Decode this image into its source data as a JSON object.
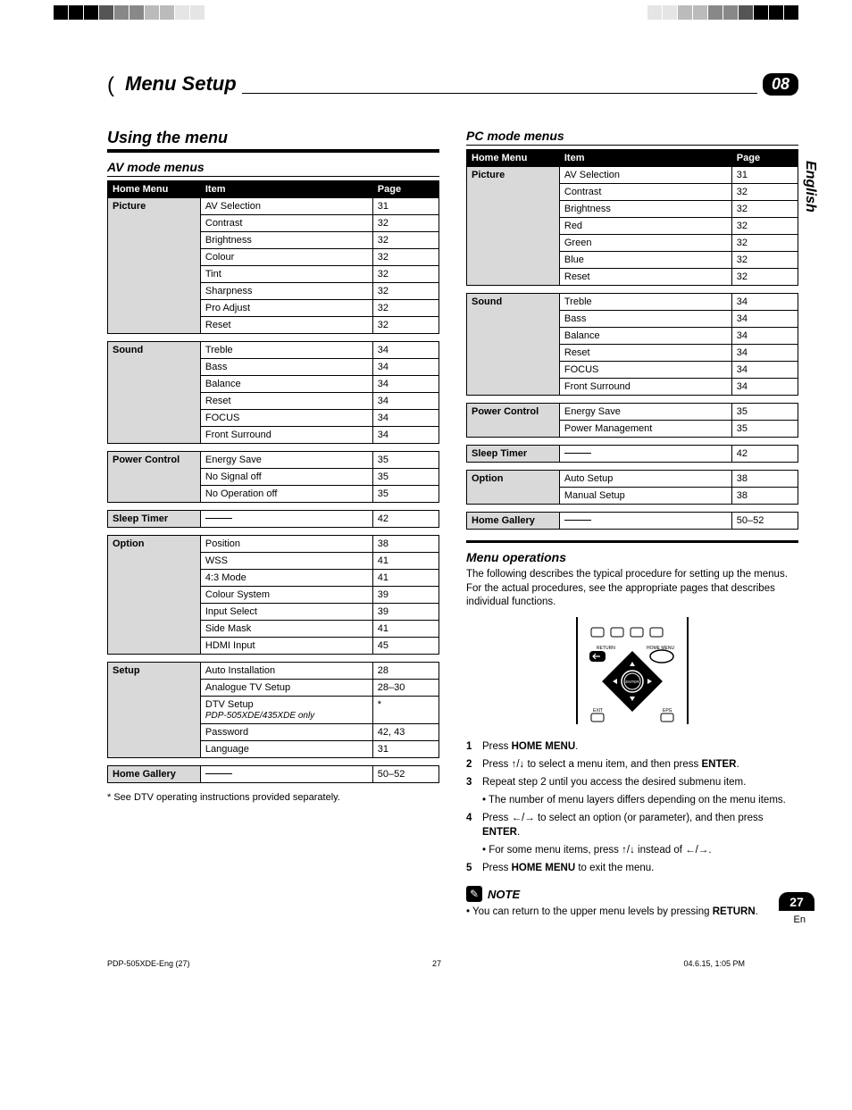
{
  "chapter": {
    "title": "Menu Setup",
    "number": "08"
  },
  "language_tab": "English",
  "page_number": "27",
  "page_lang": "En",
  "left": {
    "section_title": "Using the menu",
    "sub_title": "AV mode menus",
    "tables": {
      "headers": [
        "Home Menu",
        "Item",
        "Page"
      ],
      "groups": [
        {
          "home": "Picture",
          "rows": [
            {
              "item": "AV Selection",
              "page": "31"
            },
            {
              "item": "Contrast",
              "page": "32"
            },
            {
              "item": "Brightness",
              "page": "32"
            },
            {
              "item": "Colour",
              "page": "32"
            },
            {
              "item": "Tint",
              "page": "32"
            },
            {
              "item": "Sharpness",
              "page": "32"
            },
            {
              "item": "Pro Adjust",
              "page": "32"
            },
            {
              "item": "Reset",
              "page": "32"
            }
          ]
        },
        {
          "home": "Sound",
          "rows": [
            {
              "item": "Treble",
              "page": "34"
            },
            {
              "item": "Bass",
              "page": "34"
            },
            {
              "item": "Balance",
              "page": "34"
            },
            {
              "item": "Reset",
              "page": "34"
            },
            {
              "item": "FOCUS",
              "page": "34"
            },
            {
              "item": "Front Surround",
              "page": "34"
            }
          ]
        },
        {
          "home": "Power Control",
          "rows": [
            {
              "item": "Energy Save",
              "page": "35"
            },
            {
              "item": "No Signal off",
              "page": "35"
            },
            {
              "item": "No Operation off",
              "page": "35"
            }
          ]
        },
        {
          "home": "Sleep Timer",
          "rows": [
            {
              "item": "—",
              "page": "42",
              "dash": true
            }
          ]
        },
        {
          "home": "Option",
          "rows": [
            {
              "item": "Position",
              "page": "38"
            },
            {
              "item": "WSS",
              "page": "41"
            },
            {
              "item": "4:3 Mode",
              "page": "41"
            },
            {
              "item": "Colour System",
              "page": "39"
            },
            {
              "item": "Input Select",
              "page": "39"
            },
            {
              "item": "Side Mask",
              "page": "41"
            },
            {
              "item": "HDMI Input",
              "page": "45"
            }
          ]
        },
        {
          "home": "Setup",
          "rows": [
            {
              "item": "Auto Installation",
              "page": "28"
            },
            {
              "item": "Analogue TV Setup",
              "page": "28–30"
            },
            {
              "item": "DTV Setup",
              "sub": "PDP-505XDE/435XDE only",
              "page": "*"
            },
            {
              "item": "Password",
              "page": "42, 43"
            },
            {
              "item": "Language",
              "page": "31"
            }
          ]
        },
        {
          "home": "Home Gallery",
          "rows": [
            {
              "item": "—",
              "page": "50–52",
              "dash": true
            }
          ]
        }
      ]
    },
    "footnote": "* See DTV operating instructions provided separately."
  },
  "right": {
    "sub_title": "PC mode menus",
    "tables": {
      "headers": [
        "Home Menu",
        "Item",
        "Page"
      ],
      "groups": [
        {
          "home": "Picture",
          "rows": [
            {
              "item": "AV Selection",
              "page": "31"
            },
            {
              "item": "Contrast",
              "page": "32"
            },
            {
              "item": "Brightness",
              "page": "32"
            },
            {
              "item": "Red",
              "page": "32"
            },
            {
              "item": "Green",
              "page": "32"
            },
            {
              "item": "Blue",
              "page": "32"
            },
            {
              "item": "Reset",
              "page": "32"
            }
          ]
        },
        {
          "home": "Sound",
          "rows": [
            {
              "item": "Treble",
              "page": "34"
            },
            {
              "item": "Bass",
              "page": "34"
            },
            {
              "item": "Balance",
              "page": "34"
            },
            {
              "item": "Reset",
              "page": "34"
            },
            {
              "item": "FOCUS",
              "page": "34"
            },
            {
              "item": "Front Surround",
              "page": "34"
            }
          ]
        },
        {
          "home": "Power Control",
          "rows": [
            {
              "item": "Energy Save",
              "page": "35"
            },
            {
              "item": "Power Management",
              "page": "35"
            }
          ]
        },
        {
          "home": "Sleep Timer",
          "rows": [
            {
              "item": "—",
              "page": "42",
              "dash": true
            }
          ]
        },
        {
          "home": "Option",
          "rows": [
            {
              "item": "Auto Setup",
              "page": "38"
            },
            {
              "item": "Manual Setup",
              "page": "38"
            }
          ]
        },
        {
          "home": "Home Gallery",
          "rows": [
            {
              "item": "—",
              "page": "50–52",
              "dash": true
            }
          ]
        }
      ]
    },
    "ops_title": "Menu operations",
    "ops_intro": "The following describes the typical procedure for setting up the menus. For the actual procedures, see the appropriate pages that describes individual functions.",
    "remote_labels": {
      "return": "RETURN",
      "home_menu": "HOME MENU",
      "exit": "EXIT",
      "epg": "EPG",
      "enter": "ENTER"
    },
    "steps": [
      {
        "n": "1",
        "html": "Press <b>HOME MENU</b>."
      },
      {
        "n": "2",
        "html": "Press <span class='arrow'>↑</span>/<span class='arrow'>↓</span> to select a menu item, and then press <b>ENTER</b>."
      },
      {
        "n": "3",
        "html": "Repeat step 2 until you access the desired submenu item.",
        "subs": [
          "• The number of menu layers differs depending on the menu items."
        ]
      },
      {
        "n": "4",
        "html": "Press <span class='arrow'>←</span>/<span class='arrow'>→</span> to select an option (or parameter), and then press <b>ENTER</b>.",
        "subs": [
          "• For some menu items, press <span class='arrow'>↑</span>/<span class='arrow'>↓</span> instead of <span class='arrow'>←</span>/<span class='arrow'>→</span>."
        ]
      },
      {
        "n": "5",
        "html": "Press <b>HOME MENU</b> to exit the menu."
      }
    ],
    "note_label": "NOTE",
    "note_text": "• You can return to the upper menu levels by pressing <b>RETURN</b>."
  },
  "footer": {
    "file": "PDP-505XDE-Eng (27)",
    "page": "27",
    "timestamp": "04.6.15, 1:05 PM"
  }
}
